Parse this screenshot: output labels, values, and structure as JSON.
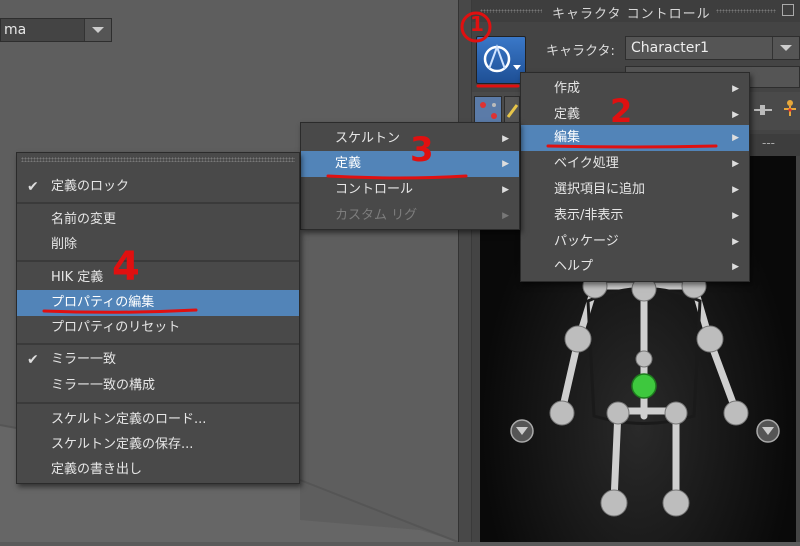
{
  "viewport": {
    "dropdown_value": "ma"
  },
  "panel": {
    "title": "キャラクタ コントロール",
    "character_label": "キャラクタ:",
    "character_value": "Character1",
    "dashes": "---"
  },
  "menu_main": {
    "items": [
      {
        "label": "作成"
      },
      {
        "label": "定義"
      },
      {
        "label": "編集"
      },
      {
        "label": "ベイク処理"
      },
      {
        "label": "選択項目に追加"
      },
      {
        "label": "表示/非表示"
      },
      {
        "label": "パッケージ"
      },
      {
        "label": "ヘルプ"
      }
    ]
  },
  "menu_edit": {
    "items": [
      {
        "label": "スケルトン"
      },
      {
        "label": "定義"
      },
      {
        "label": "コントロール"
      },
      {
        "label": "カスタム リグ"
      }
    ]
  },
  "menu_define": {
    "items": [
      {
        "label": "定義のロック"
      },
      {
        "label": "名前の変更"
      },
      {
        "label": "削除"
      },
      {
        "label": "HIK 定義"
      },
      {
        "label": "プロパティの編集"
      },
      {
        "label": "プロパティのリセット"
      },
      {
        "label": "ミラー一致"
      },
      {
        "label": "ミラー一致の構成"
      },
      {
        "label": "スケルトン定義のロード..."
      },
      {
        "label": "スケルトン定義の保存..."
      },
      {
        "label": "定義の書き出し"
      }
    ]
  },
  "annotations": {
    "step1": "1",
    "step2": "2",
    "step3": "3",
    "step4": "4"
  },
  "colors": {
    "highlight": "#5284b8",
    "annotation": "#e01010",
    "joint_active": "#3ec83e"
  }
}
